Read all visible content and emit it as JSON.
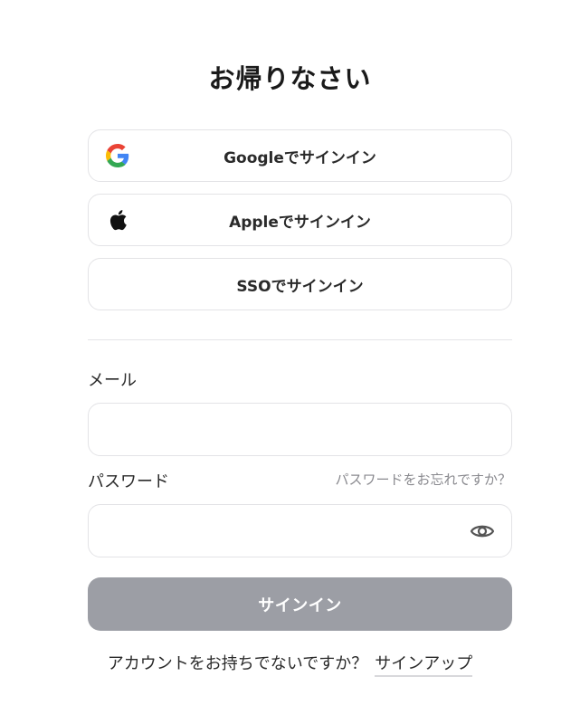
{
  "header": {
    "title": "お帰りなさい"
  },
  "oauth": {
    "google_label": "Googleでサインイン",
    "apple_label": "Appleでサインイン",
    "sso_label": "SSOでサインイン"
  },
  "form": {
    "email_label": "メール",
    "email_value": "",
    "password_label": "パスワード",
    "password_value": "",
    "forgot_password": "パスワードをお忘れですか？",
    "submit_label": "サインイン"
  },
  "footer": {
    "prompt": "アカウントをお持ちでないですか？",
    "signup_link": "サインアップ"
  },
  "icons": {
    "google": "google-icon",
    "apple": "apple-icon",
    "eye": "eye-icon"
  },
  "colors": {
    "submit_bg": "#9c9ea5",
    "border": "#e3e3e6",
    "muted_text": "#8a8a8f"
  }
}
